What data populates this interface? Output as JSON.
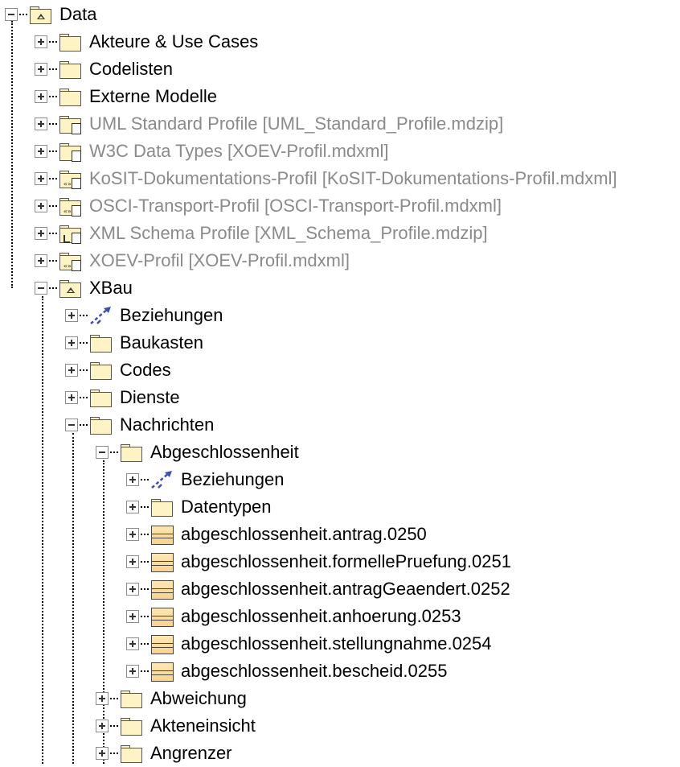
{
  "tree": {
    "root": {
      "label": "Data",
      "icon": "package-icon"
    },
    "level1": [
      {
        "label": "Akteure & Use Cases",
        "icon": "folder-icon"
      },
      {
        "label": "Codelisten",
        "icon": "folder-icon"
      },
      {
        "label": "Externe Modelle",
        "icon": "folder-icon"
      },
      {
        "label": "UML Standard Profile [UML_Standard_Profile.mdzip]",
        "icon": "profile-folder-icon"
      },
      {
        "label": "W3C Data Types [XOEV-Profil.mdxml]",
        "icon": "profile-folder-icon"
      },
      {
        "label": "KoSIT-Dokumentations-Profil [KoSIT-Dokumentations-Profil.mdxml]",
        "icon": "stereotype-profile-icon"
      },
      {
        "label": "OSCI-Transport-Profil [OSCI-Transport-Profil.mdxml]",
        "icon": "stereotype-profile-icon"
      },
      {
        "label": "XML Schema Profile [XML_Schema_Profile.mdzip]",
        "icon": "profile-folder-icon"
      },
      {
        "label": "XOEV-Profil [XOEV-Profil.mdxml]",
        "icon": "stereotype-profile-icon"
      },
      {
        "label": "XBau",
        "icon": "package-icon"
      }
    ],
    "xbau": [
      {
        "label": "Beziehungen",
        "icon": "relationship-icon"
      },
      {
        "label": "Baukasten",
        "icon": "folder-icon"
      },
      {
        "label": "Codes",
        "icon": "folder-icon"
      },
      {
        "label": "Dienste",
        "icon": "folder-icon"
      },
      {
        "label": "Nachrichten",
        "icon": "folder-icon"
      }
    ],
    "nachrichten": [
      {
        "label": "Abgeschlossenheit",
        "icon": "folder-icon"
      },
      {
        "label": "Abweichung",
        "icon": "folder-icon"
      },
      {
        "label": "Akteneinsicht",
        "icon": "folder-icon"
      },
      {
        "label": "Angrenzer",
        "icon": "folder-icon"
      }
    ],
    "abgeschlossenheit": [
      {
        "label": "Beziehungen",
        "icon": "relationship-icon"
      },
      {
        "label": "Datentypen",
        "icon": "folder-icon"
      },
      {
        "label": "abgeschlossenheit.antrag.0250",
        "icon": "message-class-icon"
      },
      {
        "label": "abgeschlossenheit.formellePruefung.0251",
        "icon": "message-class-icon"
      },
      {
        "label": "abgeschlossenheit.antragGeaendert.0252",
        "icon": "message-class-icon"
      },
      {
        "label": "abgeschlossenheit.anhoerung.0253",
        "icon": "message-class-icon"
      },
      {
        "label": "abgeschlossenheit.stellungnahme.0254",
        "icon": "message-class-icon"
      },
      {
        "label": "abgeschlossenheit.bescheid.0255",
        "icon": "message-class-icon"
      }
    ]
  },
  "colors": {
    "text": "#000000",
    "grayed_text": "#8a8a8a",
    "folder_fill": "#fdf3c4",
    "relation_blue": "#3f4fb0"
  }
}
